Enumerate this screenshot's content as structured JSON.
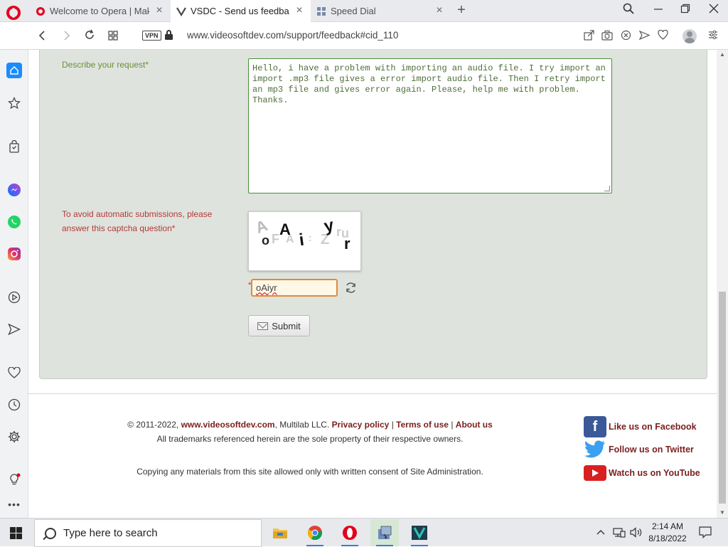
{
  "browser": {
    "tabs": [
      {
        "label": "Welcome to Opera | Make",
        "active": false
      },
      {
        "label": "VSDC - Send us feedback",
        "active": true
      },
      {
        "label": "Speed Dial",
        "active": false
      }
    ],
    "new_tab": "+",
    "url": "www.videosoftdev.com/support/feedback#cid_110",
    "vpn_label": "VPN"
  },
  "form": {
    "describe_label": "Describe your request*",
    "request_text": "Hello, i have a problem with importing an audio file. I try import an import .mp3 file gives a error import audio file. Then I retry import an mp3 file and gives error again. Please, help me with problem. Thanks.",
    "captcha_label": "To avoid automatic submissions, please answer this captcha question*",
    "captcha_value": "oAiyr",
    "required_star": "*",
    "submit_label": "Submit"
  },
  "footer": {
    "copyright_prefix": "© 2011-2022,",
    "site_link": "www.videosoftdev.com",
    "company": ", Multilab LLC.",
    "privacy": "Privacy policy",
    "sep1": "|",
    "terms": "Terms of use",
    "sep2": "|",
    "about": "About us",
    "trademarks": "All trademarks referenced herein are the sole property of their respective owners.",
    "copying": "Copying any materials from this site allowed only with written consent of Site Administration."
  },
  "social": {
    "facebook": "Like us on Facebook",
    "twitter": "Follow us on Twitter",
    "youtube": "Watch us on YouTube"
  },
  "taskbar": {
    "search_placeholder": "Type here to search",
    "time": "2:14 AM",
    "date": "8/18/2022"
  },
  "colors": {
    "form_bg": "#dfe3dd",
    "label_green": "#6b8f3a",
    "label_red": "#b23a3a",
    "link_dark_red": "#7a1f1f",
    "opera_red": "#e3001b"
  }
}
